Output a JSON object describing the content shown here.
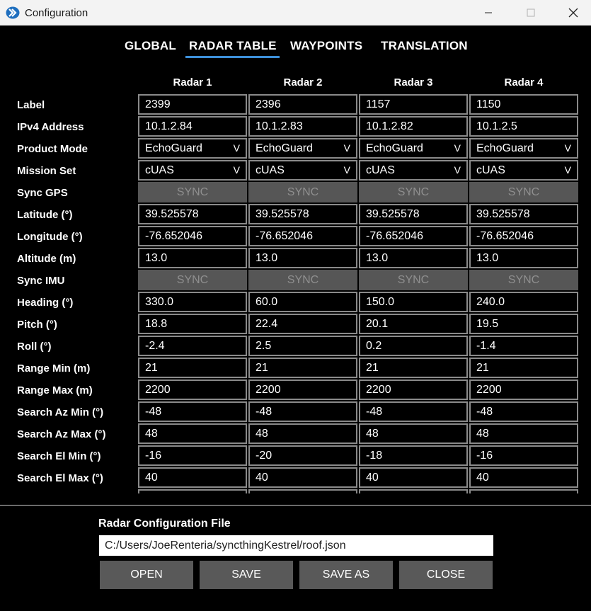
{
  "window": {
    "title": "Configuration",
    "minimize_glyph": "—",
    "maximize_glyph": "☐",
    "close_glyph": "✕",
    "icon": "app-logo-icon"
  },
  "tabs": [
    {
      "label": "GLOBAL",
      "active": false
    },
    {
      "label": "RADAR TABLE",
      "active": true
    },
    {
      "label": "WAYPOINTS",
      "active": false
    },
    {
      "label": "TRANSLATION",
      "active": false
    }
  ],
  "radars": [
    "Radar 1",
    "Radar 2",
    "Radar 3",
    "Radar 4"
  ],
  "rows": [
    {
      "label": "Label",
      "type": "text",
      "values": [
        "2399",
        "2396",
        "1157",
        "1150"
      ]
    },
    {
      "label": "IPv4 Address",
      "type": "text",
      "values": [
        "10.1.2.84",
        "10.1.2.83",
        "10.1.2.82",
        "10.1.2.5"
      ]
    },
    {
      "label": "Product Mode",
      "type": "select",
      "values": [
        "EchoGuard",
        "EchoGuard",
        "EchoGuard",
        "EchoGuard"
      ]
    },
    {
      "label": "Mission Set",
      "type": "select",
      "values": [
        "cUAS",
        "cUAS",
        "cUAS",
        "cUAS"
      ]
    },
    {
      "label": "Sync GPS",
      "type": "button",
      "values": [
        "SYNC",
        "SYNC",
        "SYNC",
        "SYNC"
      ]
    },
    {
      "label": "Latitude (°)",
      "type": "text",
      "values": [
        "39.525578",
        "39.525578",
        "39.525578",
        "39.525578"
      ]
    },
    {
      "label": "Longitude (°)",
      "type": "text",
      "values": [
        "-76.652046",
        "-76.652046",
        "-76.652046",
        "-76.652046"
      ]
    },
    {
      "label": "Altitude (m)",
      "type": "text",
      "values": [
        "13.0",
        "13.0",
        "13.0",
        "13.0"
      ]
    },
    {
      "label": "Sync IMU",
      "type": "button",
      "values": [
        "SYNC",
        "SYNC",
        "SYNC",
        "SYNC"
      ]
    },
    {
      "label": "Heading (°)",
      "type": "text",
      "values": [
        "330.0",
        "60.0",
        "150.0",
        "240.0"
      ]
    },
    {
      "label": "Pitch (°)",
      "type": "text",
      "values": [
        "18.8",
        "22.4",
        "20.1",
        "19.5"
      ]
    },
    {
      "label": "Roll (°)",
      "type": "text",
      "values": [
        "-2.4",
        "2.5",
        "0.2",
        "-1.4"
      ]
    },
    {
      "label": "Range Min (m)",
      "type": "text",
      "values": [
        "21",
        "21",
        "21",
        "21"
      ]
    },
    {
      "label": "Range Max (m)",
      "type": "text",
      "values": [
        "2200",
        "2200",
        "2200",
        "2200"
      ]
    },
    {
      "label": "Search Az Min (°)",
      "type": "text",
      "values": [
        "-48",
        "-48",
        "-48",
        "-48"
      ]
    },
    {
      "label": "Search Az Max (°)",
      "type": "text",
      "values": [
        "48",
        "48",
        "48",
        "48"
      ]
    },
    {
      "label": "Search El Min (°)",
      "type": "text",
      "values": [
        "-16",
        "-20",
        "-18",
        "-16"
      ]
    },
    {
      "label": "Search El Max (°)",
      "type": "text",
      "values": [
        "40",
        "40",
        "40",
        "40"
      ]
    }
  ],
  "select_chevron": "V",
  "file_section": {
    "title": "Radar Configuration File",
    "path": "C:/Users/JoeRenteria/syncthingKestrel/roof.json",
    "buttons": [
      "OPEN",
      "SAVE",
      "SAVE AS",
      "CLOSE"
    ]
  },
  "colors": {
    "background": "#000000",
    "tab_underline": "#3d8fd8",
    "cell_border": "#8a8a8a",
    "sync_button": "#565656",
    "action_button": "#595959"
  }
}
